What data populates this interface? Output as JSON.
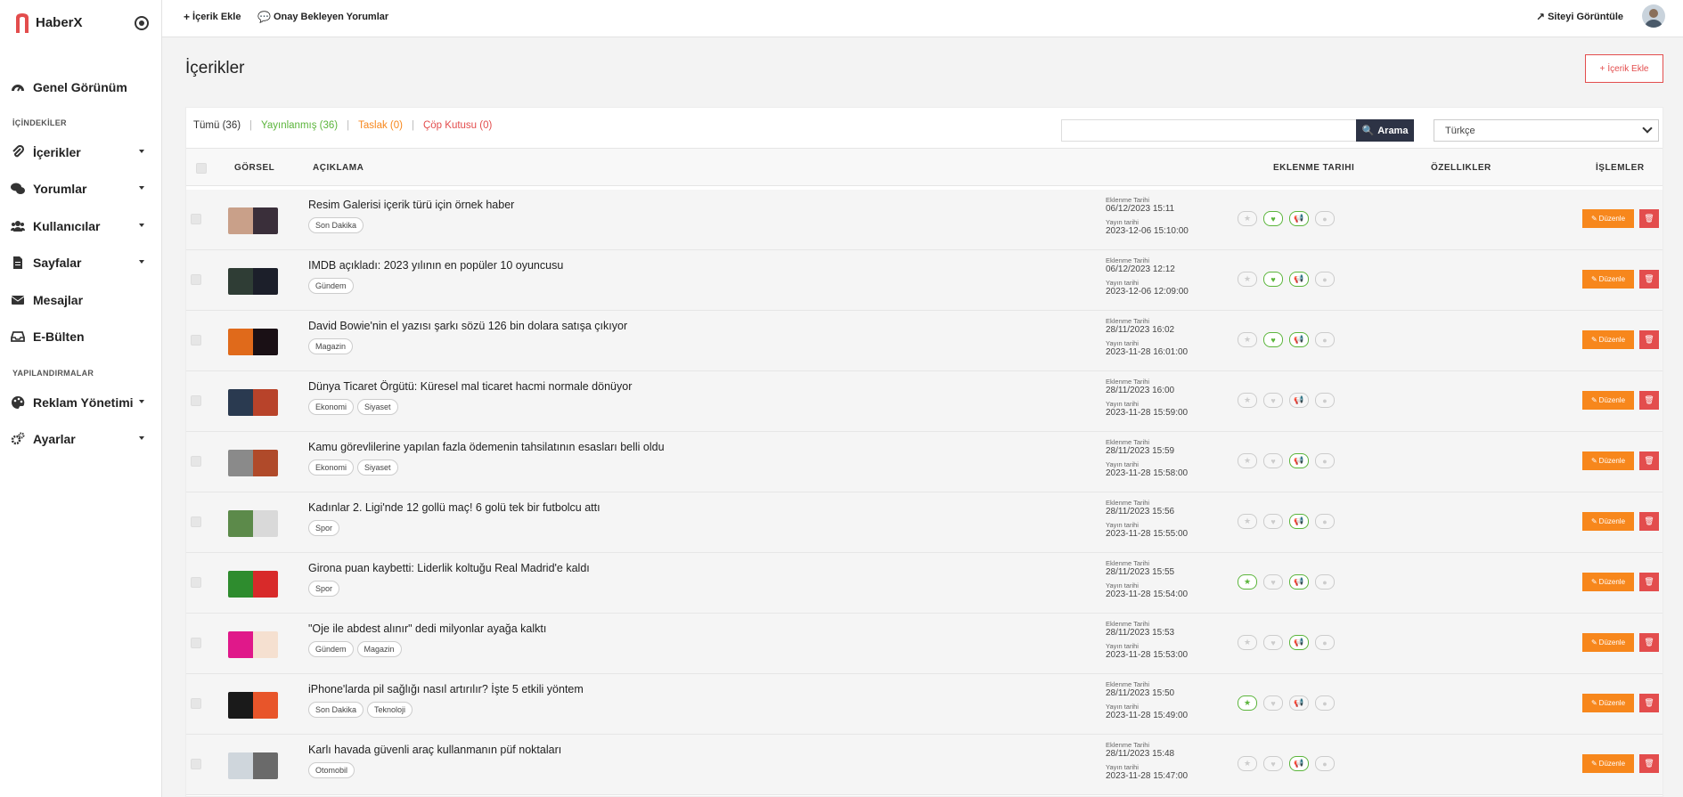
{
  "brand": {
    "name": "HaberX"
  },
  "sidebar": {
    "main": {
      "label": "Genel Görünüm"
    },
    "section1": "İÇİNDEKİLER",
    "items1": [
      {
        "label": "İçerikler",
        "icon": "paperclip-icon"
      },
      {
        "label": "Yorumlar",
        "icon": "comments-icon"
      },
      {
        "label": "Kullanıcılar",
        "icon": "users-icon"
      },
      {
        "label": "Sayfalar",
        "icon": "file-icon"
      },
      {
        "label": "Mesajlar",
        "icon": "envelope-icon"
      },
      {
        "label": "E-Bülten",
        "icon": "inbox-icon"
      }
    ],
    "section2": "YAPILANDIRMALAR",
    "items2": [
      {
        "label": "Reklam Yönetimi",
        "icon": "palette-icon"
      },
      {
        "label": "Ayarlar",
        "icon": "cogs-icon"
      }
    ]
  },
  "topbar": {
    "add_content": "İçerik Ekle",
    "pending_comments": "Onay Bekleyen Yorumlar",
    "view_site": "Siteyi Görüntüle"
  },
  "page": {
    "title": "İçerikler",
    "add_button": "İçerik Ekle"
  },
  "filters": {
    "all": "Tümü (36)",
    "published": "Yayınlanmış (36)",
    "draft": "Taslak (0)",
    "trash": "Çöp Kutusu (0)"
  },
  "search": {
    "button": "Arama",
    "value": ""
  },
  "language": {
    "selected": "Türkçe"
  },
  "columns": {
    "image": "GÖRSEL",
    "desc": "AÇIKLAMA",
    "date": "EKLENME TARIHI",
    "features": "ÖZELLIKLER",
    "actions": "İŞLEMLER"
  },
  "labels": {
    "added": "Eklenme Tarihi",
    "published": "Yayın tarihi",
    "edit": "Düzenle"
  },
  "colors": {
    "accent": "#e34d4d",
    "published": "#5bb53b",
    "draft": "#f7871c",
    "trash": "#e34d4d",
    "edit": "#f7871c",
    "delete": "#e34d4d"
  },
  "rows": [
    {
      "title": "Resim Galerisi içerik türü için örnek haber",
      "tags": [
        "Son Dakika"
      ],
      "added": "06/12/2023 15:11",
      "published": "2023-12-06 15:10:00",
      "star": false,
      "heart": true,
      "megaphone": true
    },
    {
      "title": "IMDB açıkladı: 2023 yılının en popüler 10 oyuncusu",
      "tags": [
        "Gündem"
      ],
      "added": "06/12/2023 12:12",
      "published": "2023-12-06 12:09:00",
      "star": false,
      "heart": true,
      "megaphone": true
    },
    {
      "title": "David Bowie'nin el yazısı şarkı sözü 126 bin dolara satışa çıkıyor",
      "tags": [
        "Magazin"
      ],
      "added": "28/11/2023 16:02",
      "published": "2023-11-28 16:01:00",
      "star": false,
      "heart": true,
      "megaphone": true
    },
    {
      "title": "Dünya Ticaret Örgütü: Küresel mal ticaret hacmi normale dönüyor",
      "tags": [
        "Ekonomi",
        "Siyaset"
      ],
      "added": "28/11/2023 16:00",
      "published": "2023-11-28 15:59:00",
      "star": false,
      "heart": false,
      "megaphone": false
    },
    {
      "title": "Kamu görevlilerine yapılan fazla ödemenin tahsilatının esasları belli oldu",
      "tags": [
        "Ekonomi",
        "Siyaset"
      ],
      "added": "28/11/2023 15:59",
      "published": "2023-11-28 15:58:00",
      "star": false,
      "heart": false,
      "megaphone": true
    },
    {
      "title": "Kadınlar 2. Ligi'nde 12 gollü maç! 6 golü tek bir futbolcu attı",
      "tags": [
        "Spor"
      ],
      "added": "28/11/2023 15:56",
      "published": "2023-11-28 15:55:00",
      "star": false,
      "heart": false,
      "megaphone": true
    },
    {
      "title": "Girona puan kaybetti: Liderlik koltuğu Real Madrid'e kaldı",
      "tags": [
        "Spor"
      ],
      "added": "28/11/2023 15:55",
      "published": "2023-11-28 15:54:00",
      "star": true,
      "heart": false,
      "megaphone": true
    },
    {
      "title": "\"Oje ile abdest alınır\" dedi milyonlar ayağa kalktı",
      "tags": [
        "Gündem",
        "Magazin"
      ],
      "added": "28/11/2023 15:53",
      "published": "2023-11-28 15:53:00",
      "star": false,
      "heart": false,
      "megaphone": true
    },
    {
      "title": "iPhone'larda pil sağlığı nasıl artırılır? İşte 5 etkili yöntem",
      "tags": [
        "Son Dakika",
        "Teknoloji"
      ],
      "added": "28/11/2023 15:50",
      "published": "2023-11-28 15:49:00",
      "star": true,
      "heart": false,
      "megaphone": false
    },
    {
      "title": "Karlı havada güvenli araç kullanmanın püf noktaları",
      "tags": [
        "Otomobil"
      ],
      "added": "28/11/2023 15:48",
      "published": "2023-11-28 15:47:00",
      "star": false,
      "heart": false,
      "megaphone": true
    }
  ]
}
